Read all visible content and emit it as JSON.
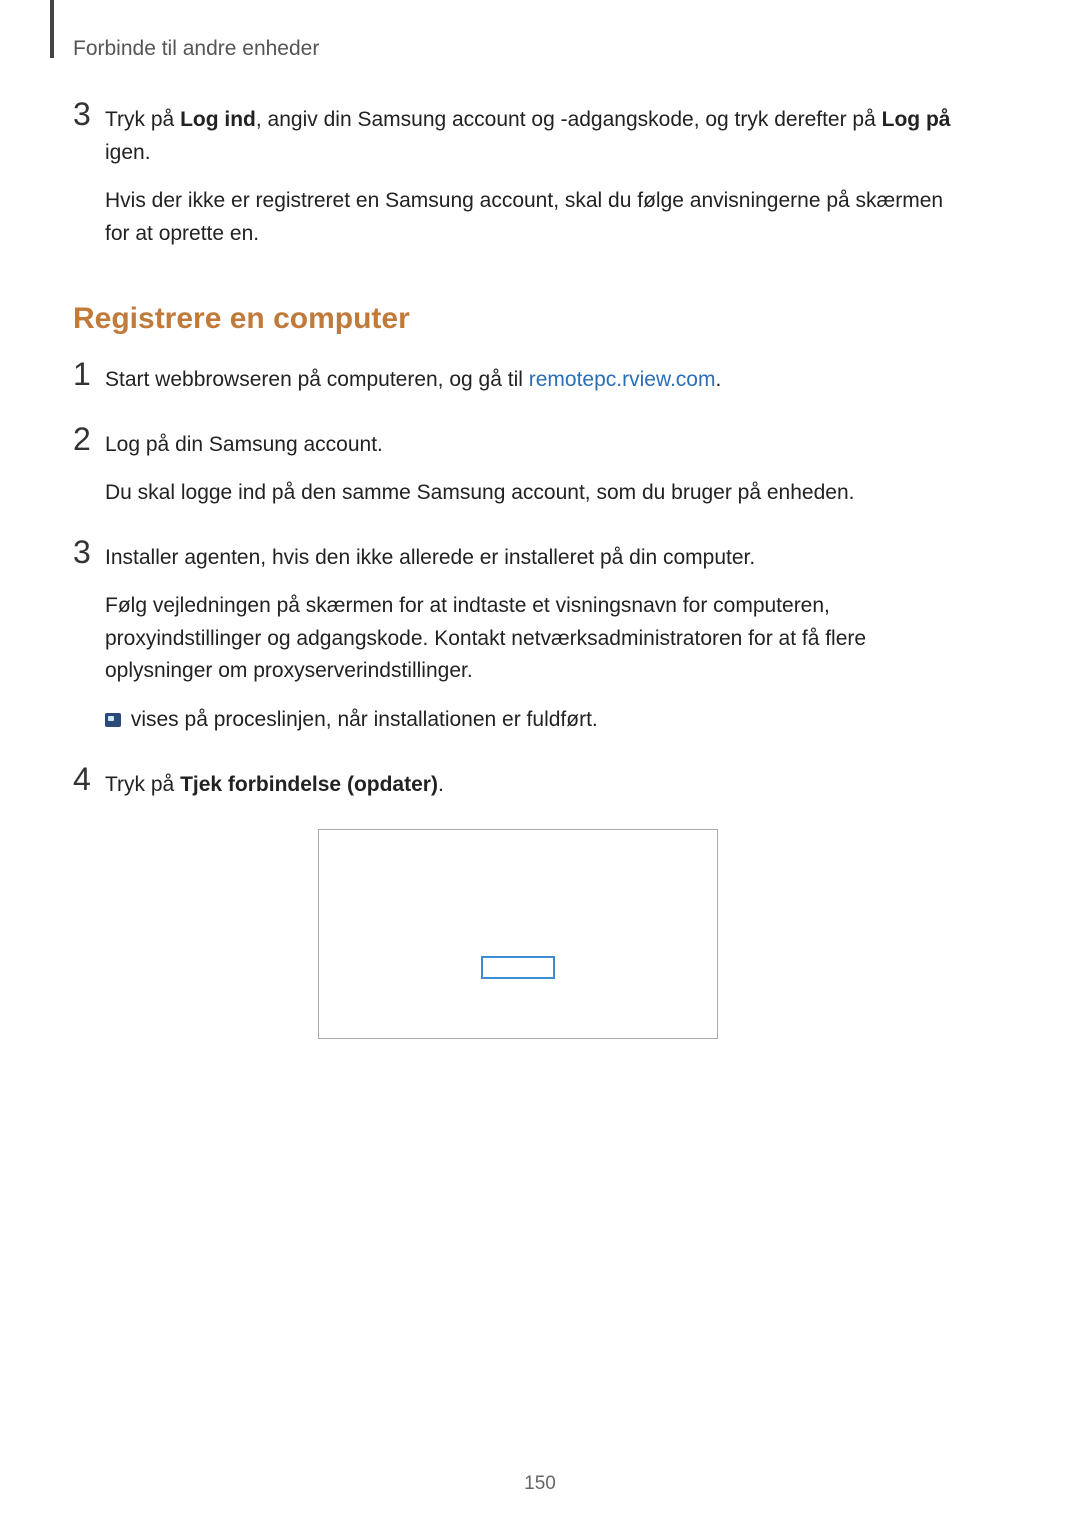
{
  "header": {
    "title": "Forbinde til andre enheder"
  },
  "top_step": {
    "number": "3",
    "para1_a": "Tryk på ",
    "para1_b": "Log ind",
    "para1_c": ", angiv din Samsung account og -adgangskode, og tryk derefter på ",
    "para1_d": "Log på",
    "para1_e": " igen.",
    "para2": "Hvis der ikke er registreret en Samsung account, skal du følge anvisningerne på skærmen for at oprette en."
  },
  "section_heading": "Registrere en computer",
  "steps": [
    {
      "number": "1",
      "para1_a": "Start webbrowseren på computeren, og gå til ",
      "link": "remotepc.rview.com",
      "para1_b": "."
    },
    {
      "number": "2",
      "para1": "Log på din Samsung account.",
      "para2": "Du skal logge ind på den samme Samsung account, som du bruger på enheden."
    },
    {
      "number": "3",
      "para1": "Installer agenten, hvis den ikke allerede er installeret på din computer.",
      "para2": "Følg vejledningen på skærmen for at indtaste et visningsnavn for computeren, proxyindstillinger og adgangskode. Kontakt netværksadministratoren for at få flere oplysninger om proxyserverindstillinger.",
      "para3": " vises på proceslinjen, når installationen er fuldført."
    },
    {
      "number": "4",
      "para1_a": "Tryk på ",
      "para1_b": "Tjek forbindelse (opdater)",
      "para1_c": "."
    }
  ],
  "page_number": "150"
}
